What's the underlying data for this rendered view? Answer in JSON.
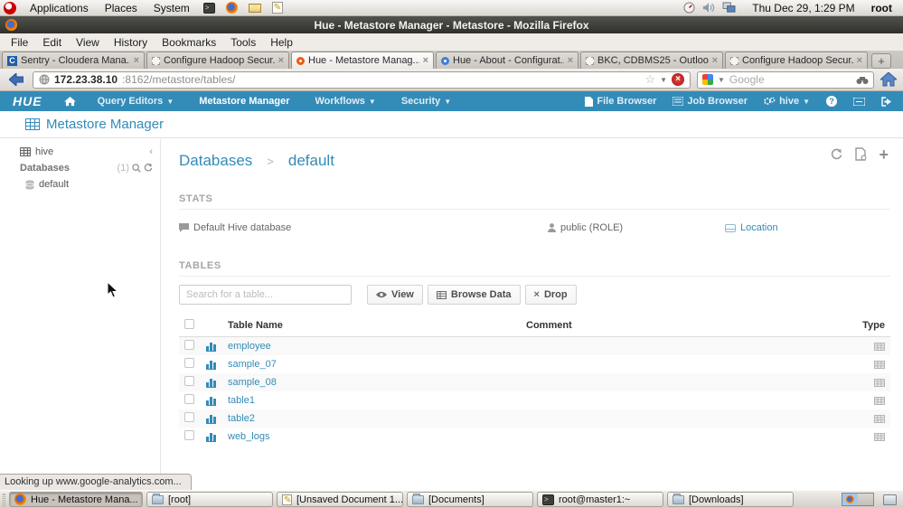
{
  "colors": {
    "hue_blue": "#338bb8",
    "link_blue": "#338bb8",
    "stop_red": "#c11b17",
    "titlebar": "#35352f"
  },
  "panel": {
    "menus": [
      {
        "label": "Applications"
      },
      {
        "label": "Places"
      },
      {
        "label": "System"
      }
    ],
    "clock": "Thu Dec 29, 1:29 PM",
    "user": "root"
  },
  "window": {
    "title": "Hue - Metastore Manager - Metastore - Mozilla Firefox"
  },
  "menubar": {
    "items": [
      {
        "label": "File"
      },
      {
        "label": "Edit"
      },
      {
        "label": "View"
      },
      {
        "label": "History"
      },
      {
        "label": "Bookmarks"
      },
      {
        "label": "Tools"
      },
      {
        "label": "Help"
      }
    ]
  },
  "tabs": [
    {
      "label": "Sentry - Cloudera Mana...",
      "icon": "cloudera-icon",
      "active": false,
      "close": "×"
    },
    {
      "label": "Configure Hadoop Secur...",
      "icon": "page-icon",
      "active": false,
      "close": "×"
    },
    {
      "label": "Hue - Metastore Manag...",
      "icon": "hue-orange-icon",
      "active": true,
      "close": "×"
    },
    {
      "label": "Hue - About - Configurat...",
      "icon": "hue-blue-icon",
      "active": false,
      "close": "×"
    },
    {
      "label": "BKC, CDBMS25 - Outloo...",
      "icon": "page-icon",
      "active": false,
      "close": "×"
    },
    {
      "label": "Configure Hadoop Secur...",
      "icon": "page-icon",
      "active": false,
      "close": "×"
    }
  ],
  "urlbar": {
    "host": "172.23.38.10",
    "path": ":8162/metastore/tables/",
    "star": "☆",
    "search_placeholder": "Google"
  },
  "hue_nav": {
    "logo": "HUE",
    "items": [
      {
        "label": "Query Editors",
        "dropdown": true,
        "active": false
      },
      {
        "label": "Metastore Manager",
        "dropdown": false,
        "active": true
      },
      {
        "label": "Workflows",
        "dropdown": true,
        "active": false
      },
      {
        "label": "Security",
        "dropdown": true,
        "active": false
      }
    ],
    "right": [
      {
        "label": "File Browser"
      },
      {
        "label": "Job Browser"
      },
      {
        "label": "hive",
        "dropdown": true
      }
    ]
  },
  "page": {
    "title": "Metastore Manager",
    "sidebar": {
      "source": "hive",
      "section": "Databases",
      "count": "(1)",
      "collapse": "‹",
      "items": [
        {
          "label": "default"
        }
      ]
    },
    "breadcrumb": {
      "parent": "Databases",
      "separator": ">",
      "current": "default"
    },
    "stats": {
      "heading": "STATS",
      "comment": "Default Hive database",
      "owner": "public (ROLE)",
      "location_label": "Location"
    },
    "tables": {
      "heading": "TABLES",
      "search_placeholder": "Search for a table...",
      "buttons": [
        {
          "label": "View"
        },
        {
          "label": "Browse Data"
        },
        {
          "label": "Drop"
        }
      ],
      "columns": {
        "name": "Table Name",
        "comment": "Comment",
        "type": "Type"
      },
      "rows": [
        {
          "name": "employee",
          "comment": ""
        },
        {
          "name": "sample_07",
          "comment": ""
        },
        {
          "name": "sample_08",
          "comment": ""
        },
        {
          "name": "table1",
          "comment": ""
        },
        {
          "name": "table2",
          "comment": ""
        },
        {
          "name": "web_logs",
          "comment": ""
        }
      ]
    }
  },
  "statusbar": {
    "text": "Looking up www.google-analytics.com..."
  },
  "taskbar": {
    "buttons": [
      {
        "label": "Hue - Metastore Mana...",
        "icon": "firefox-icon",
        "active": true
      },
      {
        "label": "[root]",
        "icon": "folder-icon",
        "active": false
      },
      {
        "label": "[Unsaved Document 1...",
        "icon": "editor-icon",
        "active": false
      },
      {
        "label": "[Documents]",
        "icon": "folder-icon",
        "active": false
      },
      {
        "label": "root@master1:~",
        "icon": "terminal-icon",
        "active": false
      },
      {
        "label": "[Downloads]",
        "icon": "folder-icon",
        "active": false
      }
    ]
  }
}
